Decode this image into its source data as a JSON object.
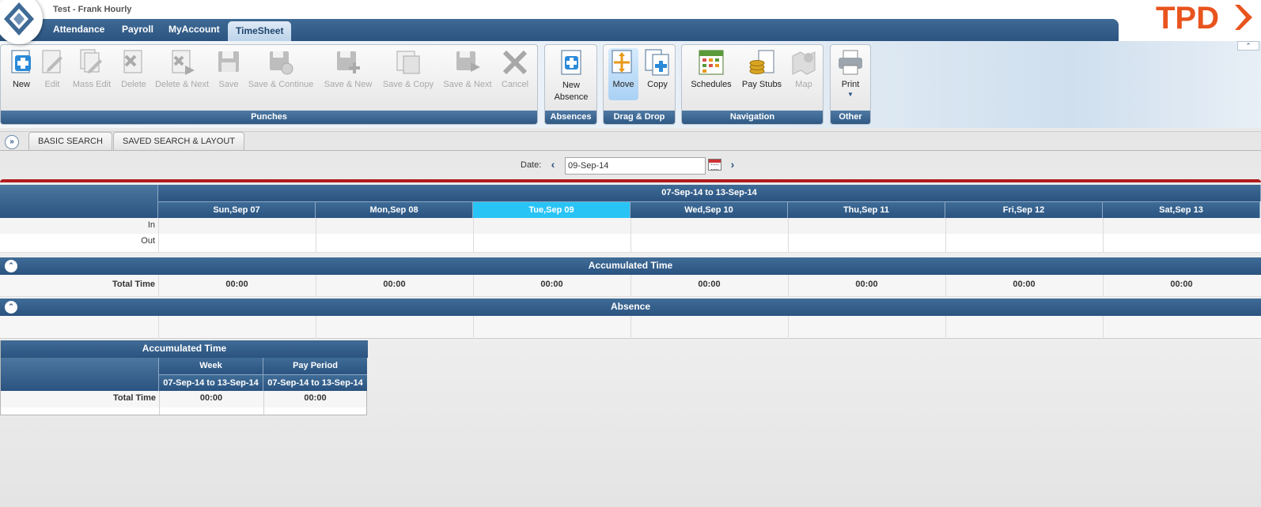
{
  "header": {
    "user_title": "Test - Frank Hourly",
    "brand": "TPD",
    "nav_tabs": [
      "Attendance",
      "Payroll",
      "MyAccount",
      "TimeSheet"
    ]
  },
  "ribbon": {
    "punches": {
      "title": "Punches",
      "buttons": [
        "New",
        "Edit",
        "Mass Edit",
        "Delete",
        "Delete & Next",
        "Save",
        "Save & Continue",
        "Save & New",
        "Save & Copy",
        "Save & Next",
        "Cancel"
      ]
    },
    "absences": {
      "title": "Absences",
      "new_absence_line1": "New",
      "new_absence_line2": "Absence"
    },
    "drag_drop": {
      "title": "Drag & Drop",
      "move": "Move",
      "copy": "Copy"
    },
    "navigation": {
      "title": "Navigation",
      "schedules": "Schedules",
      "pay_stubs": "Pay Stubs",
      "map": "Map"
    },
    "other": {
      "title": "Other",
      "print": "Print"
    }
  },
  "search": {
    "tabs": [
      "BASIC SEARCH",
      "SAVED SEARCH & LAYOUT"
    ],
    "date_label": "Date:",
    "date_value": "09-Sep-14"
  },
  "grid": {
    "range": "07-Sep-14 to 13-Sep-14",
    "days": [
      "Sun,Sep 07",
      "Mon,Sep 08",
      "Tue,Sep 09",
      "Wed,Sep 10",
      "Thu,Sep 11",
      "Fri,Sep 12",
      "Sat,Sep 13"
    ],
    "today_index": 2,
    "row_in": "In",
    "row_out": "Out",
    "accumulated_title": "Accumulated Time",
    "total_label": "Total Time",
    "totals": [
      "00:00",
      "00:00",
      "00:00",
      "00:00",
      "00:00",
      "00:00",
      "00:00"
    ],
    "absence_title": "Absence"
  },
  "summary": {
    "title": "Accumulated Time",
    "col_week": "Week",
    "col_pay_period": "Pay Period",
    "week_range": "07-Sep-14 to 13-Sep-14",
    "pay_range": "07-Sep-14 to 13-Sep-14",
    "total_label": "Total Time",
    "week_total": "00:00",
    "pay_total": "00:00"
  },
  "colors": {
    "nav_blue": "#2c5480",
    "today": "#29c4f6",
    "brand_orange": "#e8541e",
    "accent_red": "#b11c1c"
  }
}
